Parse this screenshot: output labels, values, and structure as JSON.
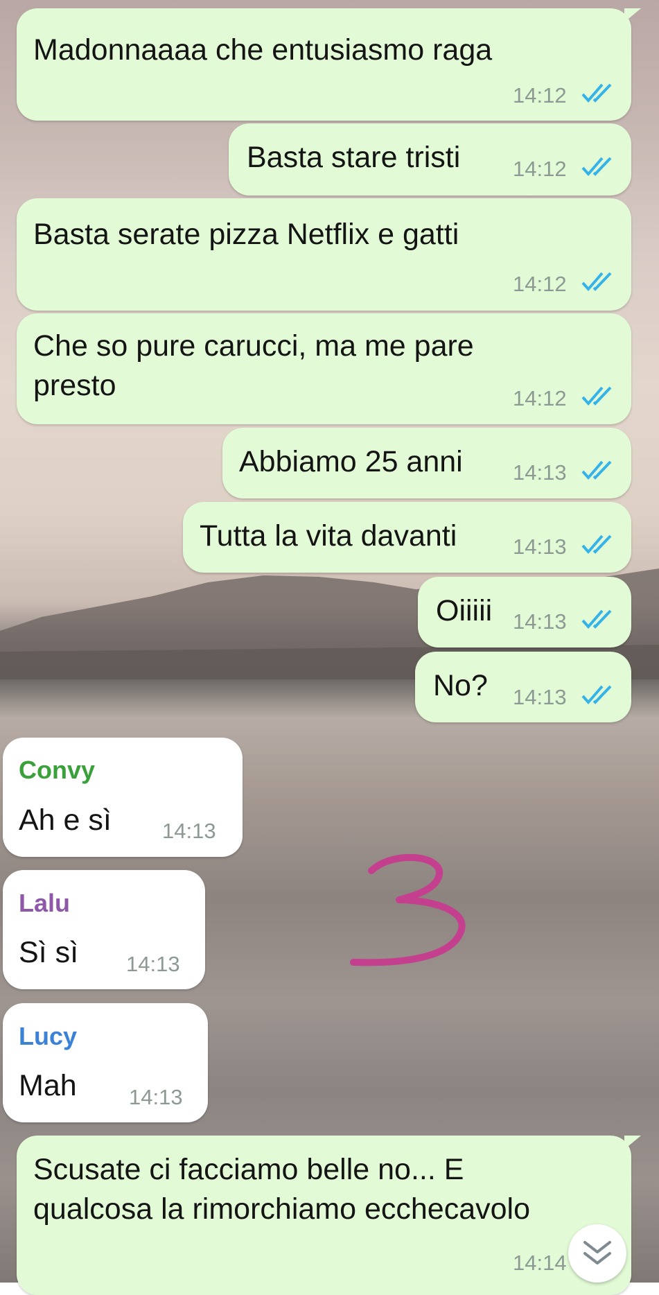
{
  "messages": [
    {
      "text": "Madonnaaaa che entusiasmo raga",
      "time": "14:12"
    },
    {
      "text": "Basta stare tristi",
      "time": "14:12"
    },
    {
      "text": "Basta serate pizza Netflix e gatti",
      "time": "14:12"
    },
    {
      "text_line1": "Che so pure carucci, ma me pare",
      "text_line2": "presto",
      "time": "14:12"
    },
    {
      "text": "Abbiamo 25 anni",
      "time": "14:13"
    },
    {
      "text": "Tutta la vita davanti",
      "time": "14:13"
    },
    {
      "text": "Oiiiii",
      "time": "14:13"
    },
    {
      "text": "No?",
      "time": "14:13"
    },
    {
      "sender": "Convy",
      "text": "Ah e sì",
      "time": "14:13"
    },
    {
      "sender": "Lalu",
      "text": "Sì sì",
      "time": "14:13"
    },
    {
      "sender": "Lucy",
      "text": "Mah",
      "time": "14:13"
    },
    {
      "text_line1": "Scusate ci facciamo belle no... E",
      "text_line2": "qualcosa la rimorchiamo ecchecavolo",
      "time": "14:14"
    }
  ],
  "colors": {
    "outgoing_bubble": "#e2fbd6",
    "incoming_bubble": "#ffffff",
    "read_ticks": "#35b3e8",
    "sender_convy": "#3aa13a",
    "sender_lalu": "#8e57a8",
    "sender_lucy": "#3b82d6",
    "annotation": "#c43f8e"
  },
  "icons": {
    "read_receipt": "double-check-icon",
    "scroll_down": "double-chevron-down-icon"
  },
  "annotation": {
    "text": "3"
  }
}
